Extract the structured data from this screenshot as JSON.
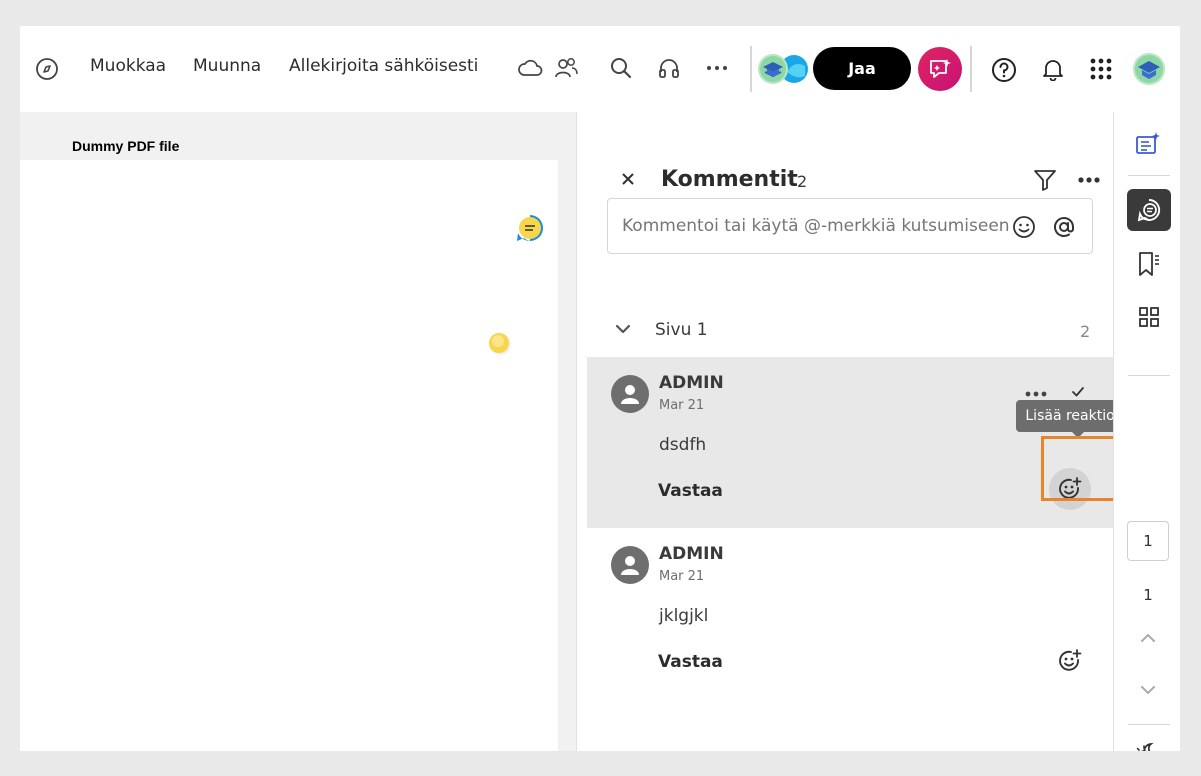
{
  "toolbar": {
    "menu": [
      "Muokkaa",
      "Muunna",
      "Allekirjoita sähköisesti"
    ],
    "share_label": "Jaa",
    "icons": [
      "compass-icon",
      "cloud-icon",
      "people-icon",
      "search-icon",
      "headphones-icon",
      "more-icon",
      "collab-avatars",
      "ai-chat-icon",
      "help-icon",
      "bell-icon",
      "apps-grid-icon",
      "user-avatar"
    ]
  },
  "document": {
    "title": "Dummy PDF file"
  },
  "comments_panel": {
    "title": "Kommentit",
    "count": "2",
    "input_placeholder": "Kommentoi tai käytä @-merkkiä kutsumiseen",
    "page_group": {
      "label": "Sivu 1",
      "count": "2"
    },
    "comments": [
      {
        "author": "ADMIN",
        "date": "Mar 21",
        "text": "dsdfh",
        "reply_label": "Vastaa"
      },
      {
        "author": "ADMIN",
        "date": "Mar 21",
        "text": "jklgjkl",
        "reply_label": "Vastaa"
      }
    ],
    "tooltip": "Lisää reaktioita"
  },
  "right_rail": {
    "page_input_value": "1",
    "total_pages": "1"
  },
  "colors": {
    "accent_orange": "#e8852b",
    "sticky_yellow": "#f7d64a",
    "sticky_blue_border": "#1e8be0",
    "share_button": "#000000",
    "ai_button": "#d9166a"
  }
}
